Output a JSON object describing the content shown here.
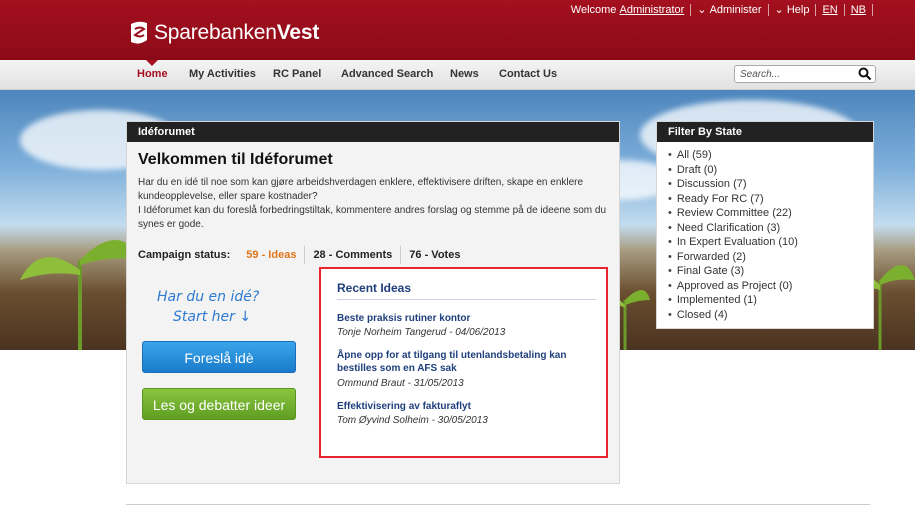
{
  "brand": {
    "name_part1": "Sparebanken",
    "name_part2": "Vest"
  },
  "toplinks": {
    "welcome": "Welcome",
    "user": "Administrator",
    "admin": "Administer",
    "help": "Help",
    "lang_en": "EN",
    "lang_nb": "NB"
  },
  "nav": {
    "items": [
      "Home",
      "My Activities",
      "RC Panel",
      "Advanced Search",
      "News",
      "Contact Us"
    ]
  },
  "search": {
    "placeholder": "Search..."
  },
  "panel": {
    "header": "Idéforumet",
    "title": "Velkommen til Idéforumet",
    "intro_1": "Har du en idé til noe som kan gjøre arbeidshverdagen enklere, effektivisere driften, skape en enklere kundeopplevelse, eller spare kostnader?",
    "intro_2": "I Idéforumet kan du foreslå forbedringstiltak, kommentere andres forslag og stemme på de ideene som du synes er gode.",
    "campaign_label": "Campaign status:",
    "ideas": "59 - Ideas",
    "comments": "28 - Comments",
    "votes": "76 - Votes",
    "handwritten_1": "Har du en idé?",
    "handwritten_2": "Start her",
    "btn_suggest": "Foreslå idè",
    "btn_read": "Les og debatter ideer"
  },
  "recent": {
    "title": "Recent Ideas",
    "items": [
      {
        "title": "Beste praksis rutiner kontor",
        "meta": "Tonje Norheim Tangerud - 04/06/2013"
      },
      {
        "title": "Åpne opp for at tilgang til utenlandsbetaling kan bestilles som en AFS sak",
        "meta": "Ommund Braut - 31/05/2013"
      },
      {
        "title": "Effektivisering av fakturaflyt",
        "meta": "Tom Øyvind Solheim - 30/05/2013"
      }
    ]
  },
  "filter": {
    "title": "Filter By State",
    "items": [
      "All (59)",
      "Draft (0)",
      "Discussion (7)",
      "Ready For RC (7)",
      "Review Committee (22)",
      "Need Clarification (3)",
      "In Expert Evaluation (10)",
      "Forwarded (2)",
      "Final Gate (3)",
      "Approved as Project (0)",
      "Implemented (1)",
      "Closed (4)"
    ]
  }
}
